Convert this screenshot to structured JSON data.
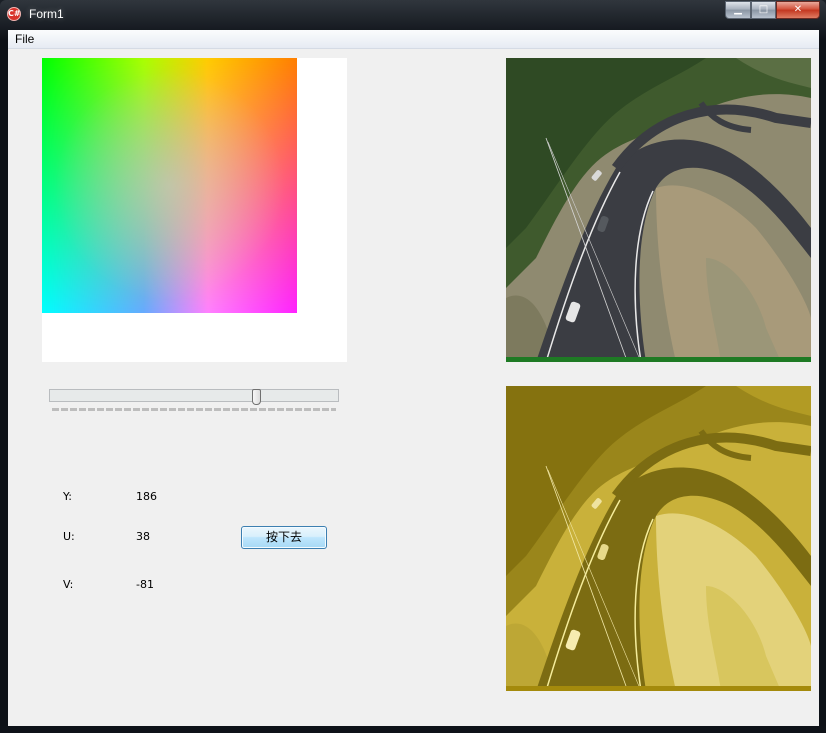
{
  "window": {
    "title": "Form1",
    "app_icon_glyph": "C#",
    "minimize_glyph": "▁",
    "maximize_glyph": "□",
    "close_glyph": "✕"
  },
  "menu": {
    "items": [
      {
        "label": "File"
      }
    ]
  },
  "slider": {
    "value_fraction": 0.72
  },
  "readouts": {
    "y_label": "Y:",
    "y_value": "186",
    "u_label": "U:",
    "u_value": "38",
    "v_label": "V:",
    "v_value": "-81"
  },
  "button": {
    "label": "按下去"
  },
  "colors": {
    "tint": "#e0c000",
    "panel_bg": "#f0f0f0",
    "button_border": "#3c7fb1"
  },
  "icons": {
    "app": "app-icon",
    "minimize": "minimize-icon",
    "maximize": "maximize-icon",
    "close": "close-icon"
  }
}
